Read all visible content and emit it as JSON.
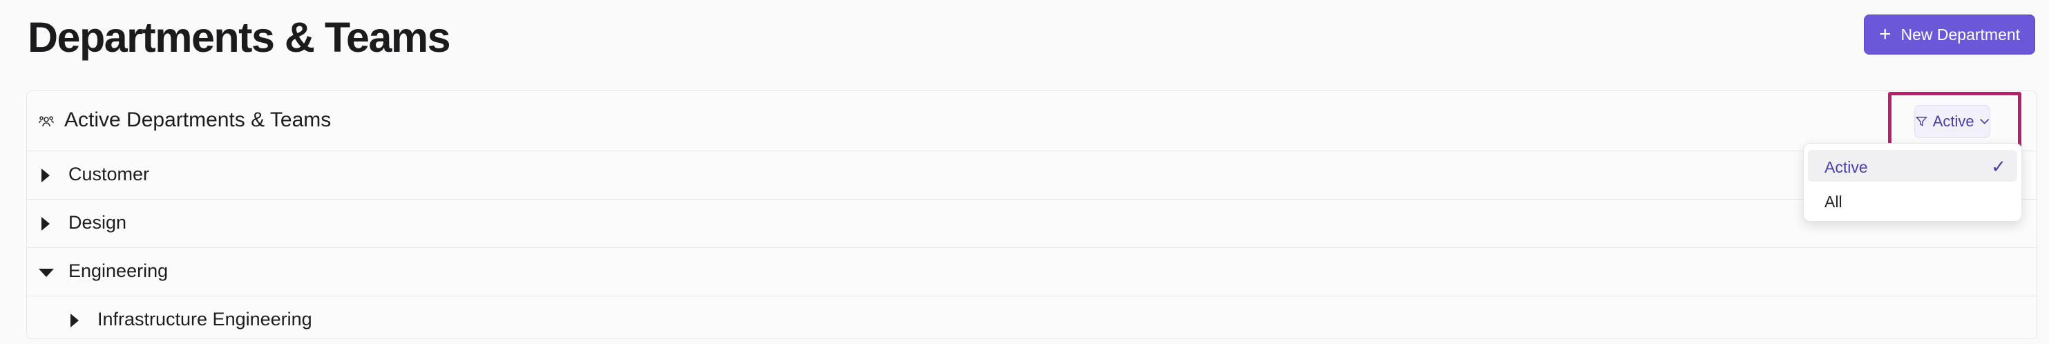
{
  "page": {
    "title": "Departments & Teams",
    "new_department_button": "New Department"
  },
  "panel": {
    "title": "Active Departments & Teams",
    "header_icon": "team-icon",
    "filter": {
      "label": "Active",
      "icon": "filter-icon",
      "options": [
        {
          "label": "Active",
          "selected": true
        },
        {
          "label": "All",
          "selected": false
        }
      ]
    },
    "rows": [
      {
        "label": "Customer",
        "expanded": false,
        "level": 0
      },
      {
        "label": "Design",
        "expanded": false,
        "level": 0
      },
      {
        "label": "Engineering",
        "expanded": true,
        "level": 0
      },
      {
        "label": "Infrastructure Engineering",
        "expanded": false,
        "level": 1
      }
    ]
  },
  "colors": {
    "accent": "#6b58d8",
    "accent_text": "#4a3fa6",
    "highlight": "#b81e6c"
  }
}
